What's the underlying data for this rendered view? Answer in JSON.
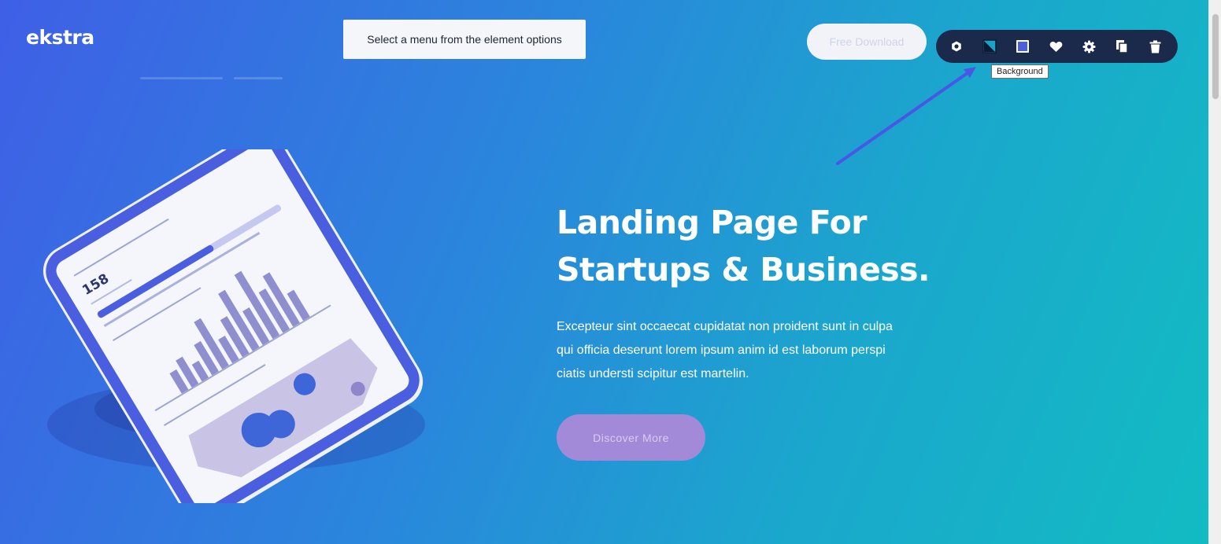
{
  "app": {
    "logo": "ekstra"
  },
  "menu_hint": "Select a menu from the element options",
  "header": {
    "cta_label": "Free Download"
  },
  "toolbar": {
    "icons": [
      "hexagon-icon",
      "background-icon",
      "color-square-icon",
      "heart-icon",
      "gear-icon",
      "duplicate-icon",
      "trash-icon"
    ],
    "tooltip": "Background"
  },
  "hero": {
    "title_line1": "Landing Page For",
    "title_line2": "Startups & Business.",
    "description": "Excepteur sint occaecat cupidatat non proident sunt in culpa qui officia deserunt lorem ipsum anim id est laborum perspi ciatis understi scipitur est martelin.",
    "button_label": "Discover More"
  },
  "phone": {
    "stat_value": "158"
  },
  "colors": {
    "gradient_start": "#3f5fe6",
    "gradient_end": "#12bcc2",
    "toolbar_bg": "#1b2a4a",
    "button_purple": "#a38ad8",
    "accent_blue": "#4a5fe0"
  }
}
